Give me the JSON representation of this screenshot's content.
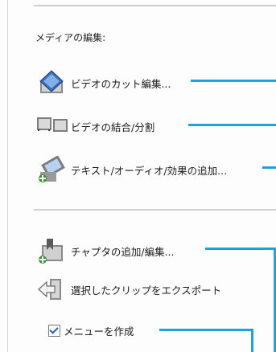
{
  "panel": {
    "heading": "メディアの編集:",
    "items": [
      {
        "label": "ビデオのカット編集...",
        "icon": "diamond-cut-icon"
      },
      {
        "label": "ビデオの結合/分割",
        "icon": "film-strips-icon"
      },
      {
        "label": "テキスト/オーディオ/効果の追加...",
        "icon": "add-effects-icon"
      },
      {
        "label": "チャプタの追加/編集...",
        "icon": "add-chapter-icon"
      },
      {
        "label": "選択したクリップをエクスポート",
        "icon": "export-arrow-icon"
      }
    ],
    "checkbox": {
      "label": "メニューを作成",
      "checked": true
    }
  },
  "colors": {
    "accent_line": "#1fa0e0"
  }
}
